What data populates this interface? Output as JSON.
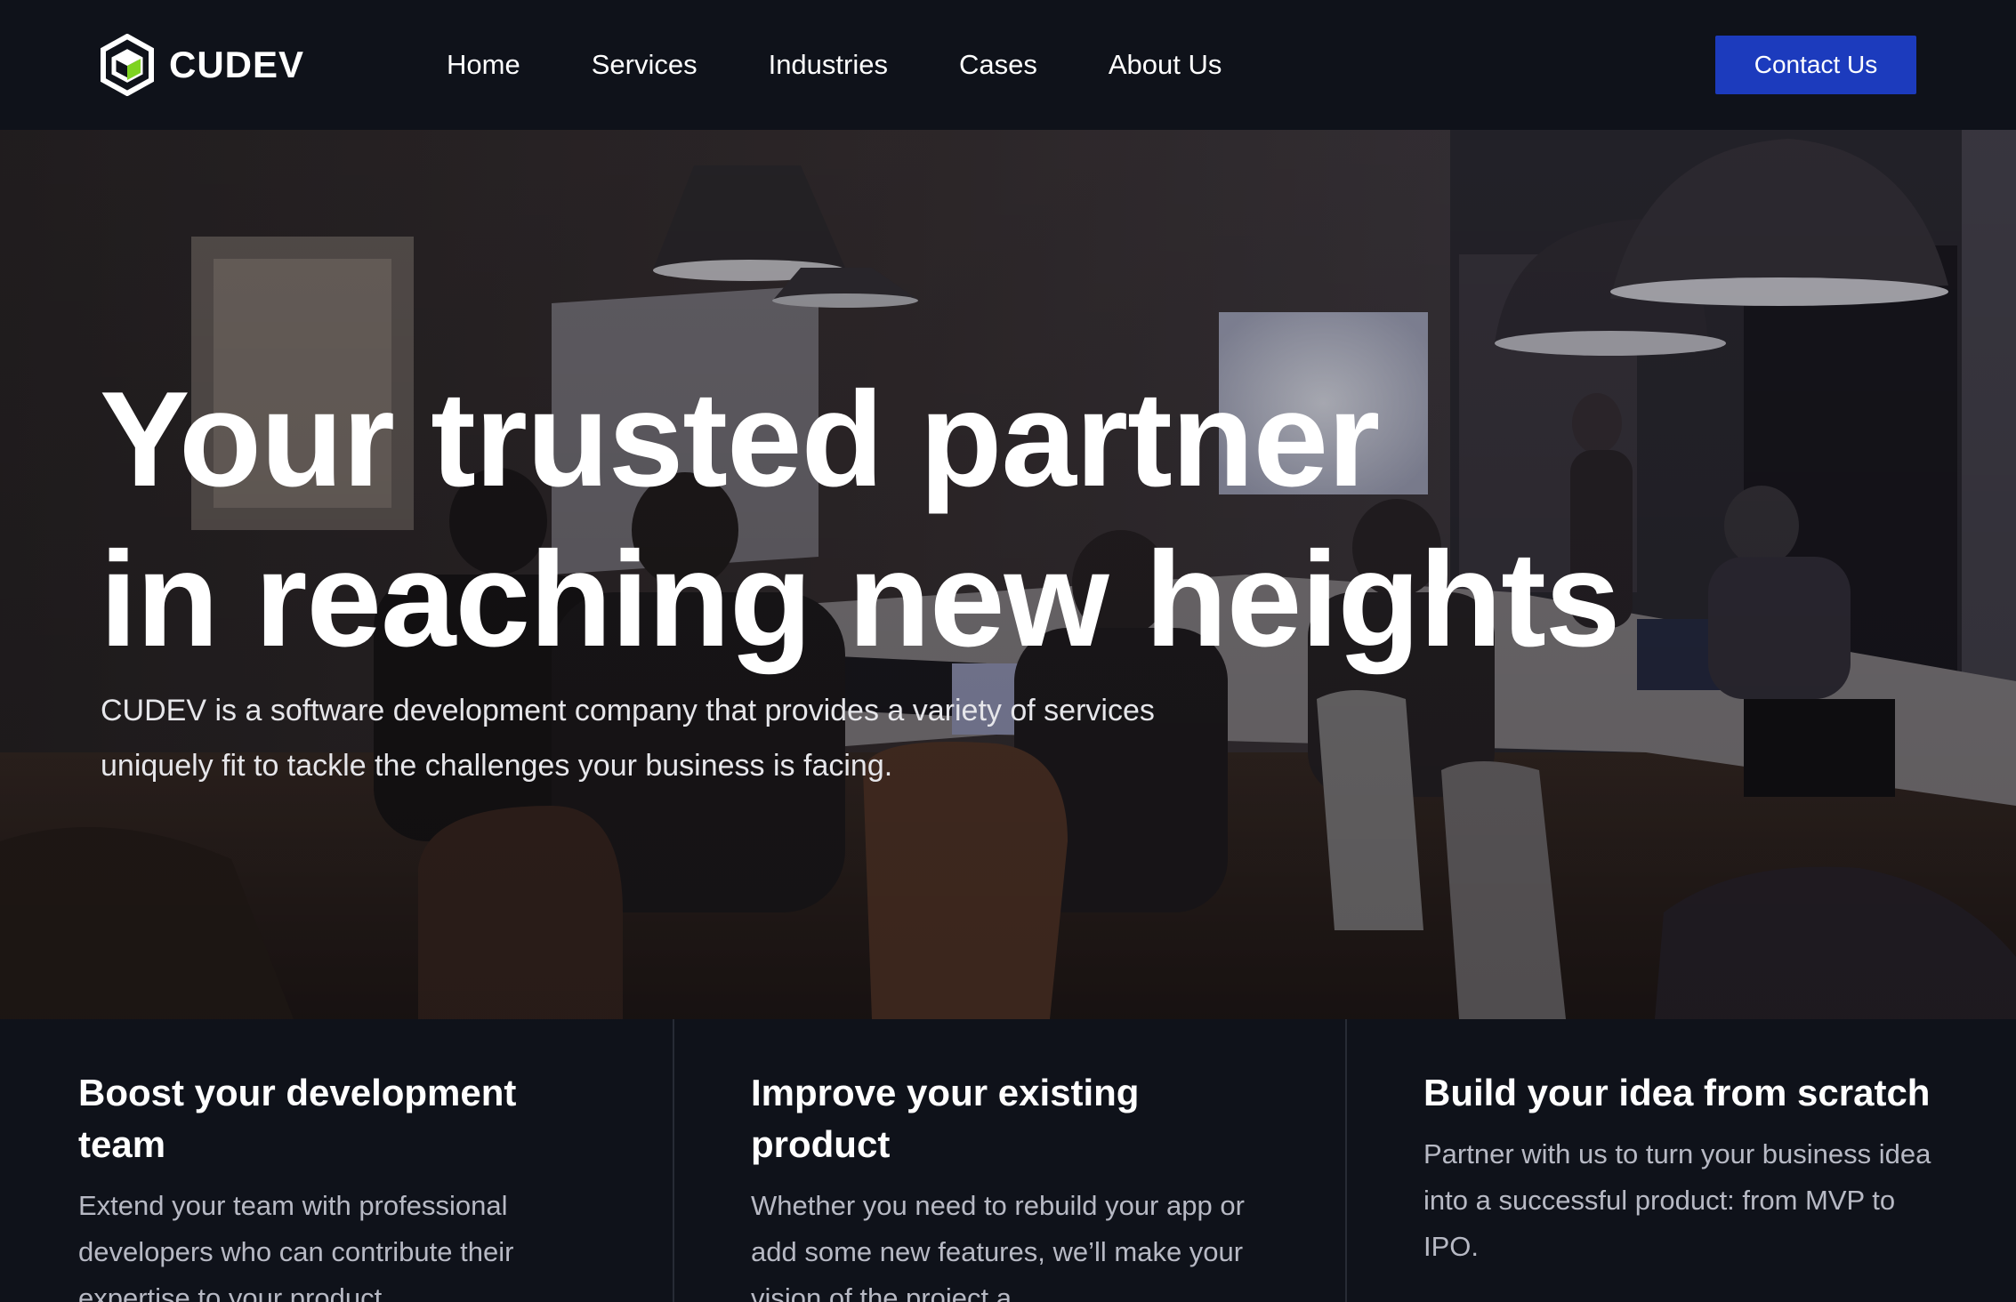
{
  "header": {
    "brand": "CUDEV",
    "logo_icon": "cube-logo-icon",
    "nav": [
      {
        "label": "Home"
      },
      {
        "label": "Services"
      },
      {
        "label": "Industries"
      },
      {
        "label": "Cases"
      },
      {
        "label": "About Us"
      }
    ],
    "contact_label": "Contact Us"
  },
  "hero": {
    "title_line1": "Your trusted partner",
    "title_line2": "in reaching new heights",
    "subtitle": "CUDEV is a software development company that provides a variety of services uniquely fit to tackle the challenges your business is facing."
  },
  "features": [
    {
      "title": "Boost your development team",
      "text": "Extend your team with professional developers who can contribute their expertise to your product."
    },
    {
      "title": "Improve your existing product",
      "text": "Whether you need to rebuild your app or add some new features, we’ll make your vision of the project a"
    },
    {
      "title": "Build your idea from scratch",
      "text": "Partner with us to turn your business idea into a successful product: from MVP to IPO."
    }
  ],
  "colors": {
    "background": "#0f121a",
    "accent": "#1c3bbd",
    "logo_green": "#7ed321"
  }
}
